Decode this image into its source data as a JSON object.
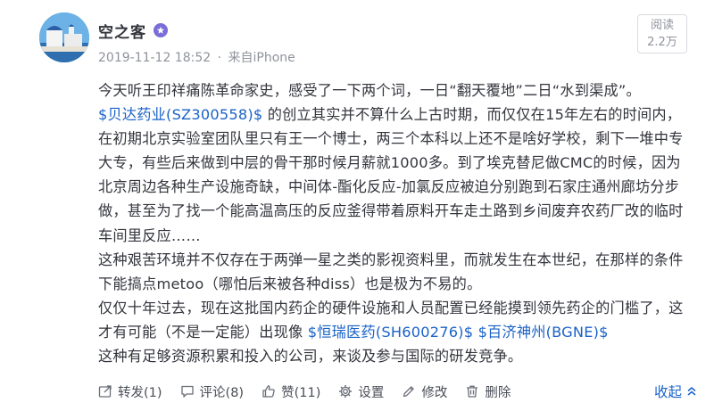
{
  "author": {
    "name": "空之客",
    "date": "2019-11-12 18:52",
    "separator": "·",
    "source": "来自iPhone"
  },
  "read_box": {
    "label": "阅读",
    "count": "2.2万"
  },
  "content": {
    "p1": {
      "intro": "今天听王印祥痛陈革命家史，感受了一下两个词，一日“翻天覆地”二日“水到渠成”。",
      "stock1": "$贝达药业(SZ300558)$",
      "body": "的创立其实并不算什么上古时期，而仅仅在15年左右的时间内，在初期北京实验室团队里只有王一个博士，两三个本科以上还不是啥好学校，剩下一堆中专大专，有些后来做到中层的骨干那时候月薪就1000多。到了埃克替尼做CMC的时候，因为北京周边各种生产设施奇缺，中间体-酯化反应-加氯反应被迫分别跑到石家庄通州廊坊分步做，甚至为了找一个能高温高压的反应釜得带着原料开车走土路到乡间废弃农药厂改的临时车间里反应……"
    },
    "p2": "这种艰苦环境并不仅存在于两弹一星之类的影视资料里，而就发生在本世纪，在那样的条件下能搞点metoo（哪怕后来被各种diss）也是极为不易的。",
    "p3": {
      "text": "仅仅十年过去，现在这批国内药企的硬件设施和人员配置已经能摸到领先药企的门槛了，这才有可能（不是一定能）出现像 ",
      "stock2": "$恒瑞医药(SH600276)$",
      "stock3": "$百济神州(BGNE)$",
      "tail": "这种有足够资源积累和投入的公司，来谈及参与国际的研发竞争。"
    }
  },
  "actions": {
    "repost": "转发(1)",
    "comment": "评论(8)",
    "like": "赞(11)",
    "settings": "设置",
    "edit": "修改",
    "delete": "删除",
    "collapse": "收起"
  },
  "colors": {
    "link": "#1a62c8",
    "badge": "#7a6dd8",
    "text": "#33353c",
    "muted": "#8f939c"
  }
}
